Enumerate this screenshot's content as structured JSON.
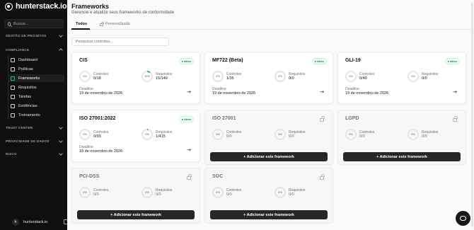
{
  "brand": {
    "name": "hunterstack.io"
  },
  "sidebar": {
    "search_placeholder": "Buscar...",
    "sections": [
      {
        "label": "GESTÃO DE PROJETOS"
      },
      {
        "label": "COMPLIANCE"
      },
      {
        "label": "TRUST CENTER"
      },
      {
        "label": "PRIVACIDADE DE DADOS"
      },
      {
        "label": "RISCO"
      }
    ],
    "items": [
      {
        "label": "Dashboard",
        "icon": "dashboard-icon"
      },
      {
        "label": "Políticas",
        "icon": "document-icon"
      },
      {
        "label": "Frameworks",
        "icon": "frameworks-icon"
      },
      {
        "label": "Requisitos",
        "icon": "checklist-icon"
      },
      {
        "label": "Tarefas",
        "icon": "tasks-icon"
      },
      {
        "label": "Evidências",
        "icon": "evidence-icon"
      },
      {
        "label": "Treinamento",
        "icon": "training-icon"
      }
    ],
    "user": {
      "initial": "h",
      "name": "hunterstack.io"
    }
  },
  "page": {
    "title": "Frameworks",
    "subtitle": "Gerencie e atualize seus frameworks de conformidade",
    "tabs": [
      {
        "label": "Todos"
      },
      {
        "label": "Personalizado"
      }
    ],
    "filter_placeholder": "Pesquisar controles..."
  },
  "labels": {
    "controls": "Controles",
    "requirements": "Requisitos",
    "deadline": "Deadline",
    "add_button": "+ Adicionar este framework",
    "active_badge": "● Ativo"
  },
  "colors": {
    "accent_green": "#22c55e",
    "primary_dark": "#27272a"
  },
  "frameworks": [
    {
      "name": "CIS",
      "active": true,
      "controls_pct": "0%",
      "controls": "0/18",
      "req_pct": "10%",
      "requirements": "15/149",
      "req_progress": 0.1,
      "deadline": "19 de novembro de 2026"
    },
    {
      "name": "MF722 (Beta)",
      "active": true,
      "controls_pct": "0%",
      "controls": "1/35",
      "req_pct": "0%",
      "requirements": "0/0",
      "req_progress": 0,
      "deadline": "19 de novembro de 2026"
    },
    {
      "name": "GLI-19",
      "active": true,
      "controls_pct": "0%",
      "controls": "0/49",
      "req_pct": "0%",
      "requirements": "0/0",
      "req_progress": 0,
      "deadline": "19 de novembro de 2026"
    },
    {
      "name": "ISO 27001:2022",
      "active": true,
      "controls_pct": "0%",
      "controls": "0/93",
      "req_pct": "0%",
      "requirements": "1/415",
      "req_progress": 0.03,
      "deadline": "19 de novembro de 2026"
    },
    {
      "name": "ISO 27001",
      "active": false,
      "controls_pct": "0%",
      "controls": "0/0",
      "req_pct": "0%",
      "requirements": "0/0",
      "req_progress": 0
    },
    {
      "name": "LGPD",
      "active": false,
      "controls_pct": "0%",
      "controls": "0/0",
      "req_pct": "0%",
      "requirements": "0/0",
      "req_progress": 0
    },
    {
      "name": "PCI-DSS",
      "active": false,
      "controls_pct": "0%",
      "controls": "0/0",
      "req_pct": "0%",
      "requirements": "0/0",
      "req_progress": 0
    },
    {
      "name": "SOC",
      "active": false,
      "controls_pct": "0%",
      "controls": "0/0",
      "req_pct": "0%",
      "requirements": "0/0",
      "req_progress": 0
    }
  ]
}
